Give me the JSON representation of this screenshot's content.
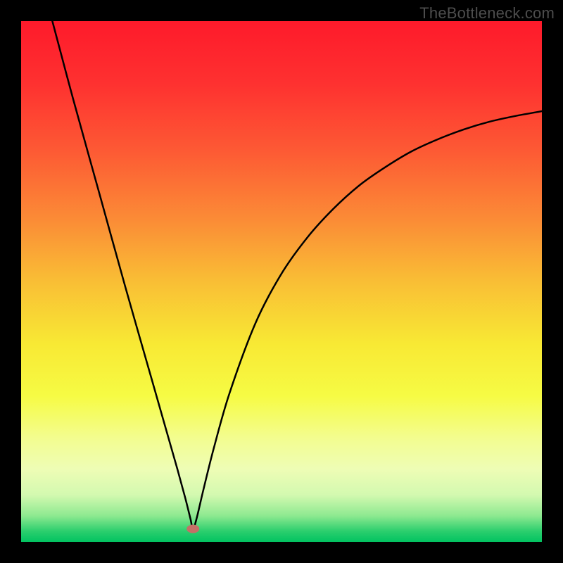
{
  "watermark": {
    "text": "TheBottleneck.com"
  },
  "chart_data": {
    "type": "line",
    "title": "",
    "xlabel": "",
    "ylabel": "",
    "xlim_pct": [
      0,
      100
    ],
    "ylim_pct": [
      0,
      100
    ],
    "minimum_marker": {
      "x_pct": 33,
      "y_pct_from_bottom": 2.5,
      "color": "#c56f67"
    },
    "curve_description": "V-shaped bottleneck curve: steep descent from upper-left to a sharp minimum near x≈33%, then asymptotically rising toward the right edge.",
    "curve_points_pct": [
      {
        "x": 6.0,
        "y_from_top": 0.0
      },
      {
        "x": 10.0,
        "y_from_top": 15.0
      },
      {
        "x": 15.0,
        "y_from_top": 33.0
      },
      {
        "x": 20.0,
        "y_from_top": 51.0
      },
      {
        "x": 25.0,
        "y_from_top": 68.5
      },
      {
        "x": 28.0,
        "y_from_top": 79.0
      },
      {
        "x": 30.0,
        "y_from_top": 86.0
      },
      {
        "x": 31.5,
        "y_from_top": 91.5
      },
      {
        "x": 32.5,
        "y_from_top": 95.5
      },
      {
        "x": 33.0,
        "y_from_top": 97.5
      },
      {
        "x": 33.7,
        "y_from_top": 95.5
      },
      {
        "x": 35.0,
        "y_from_top": 90.0
      },
      {
        "x": 37.0,
        "y_from_top": 82.0
      },
      {
        "x": 40.0,
        "y_from_top": 71.5
      },
      {
        "x": 45.0,
        "y_from_top": 58.0
      },
      {
        "x": 50.0,
        "y_from_top": 48.5
      },
      {
        "x": 55.0,
        "y_from_top": 41.5
      },
      {
        "x": 60.0,
        "y_from_top": 36.0
      },
      {
        "x": 65.0,
        "y_from_top": 31.5
      },
      {
        "x": 70.0,
        "y_from_top": 28.0
      },
      {
        "x": 75.0,
        "y_from_top": 25.0
      },
      {
        "x": 80.0,
        "y_from_top": 22.7
      },
      {
        "x": 85.0,
        "y_from_top": 20.8
      },
      {
        "x": 90.0,
        "y_from_top": 19.3
      },
      {
        "x": 95.0,
        "y_from_top": 18.2
      },
      {
        "x": 100.0,
        "y_from_top": 17.3
      }
    ],
    "background_gradient_stops": [
      {
        "offset_pct": 0,
        "color": "#fe1a2b"
      },
      {
        "offset_pct": 12,
        "color": "#fe3130"
      },
      {
        "offset_pct": 25,
        "color": "#fd5a34"
      },
      {
        "offset_pct": 38,
        "color": "#fb8b36"
      },
      {
        "offset_pct": 50,
        "color": "#f9be35"
      },
      {
        "offset_pct": 62,
        "color": "#f8e934"
      },
      {
        "offset_pct": 72,
        "color": "#f6fb44"
      },
      {
        "offset_pct": 80,
        "color": "#f3fd8f"
      },
      {
        "offset_pct": 86,
        "color": "#eefdb5"
      },
      {
        "offset_pct": 91,
        "color": "#d3f9b0"
      },
      {
        "offset_pct": 95,
        "color": "#8de990"
      },
      {
        "offset_pct": 98,
        "color": "#2ace6d"
      },
      {
        "offset_pct": 100,
        "color": "#02c361"
      }
    ]
  }
}
